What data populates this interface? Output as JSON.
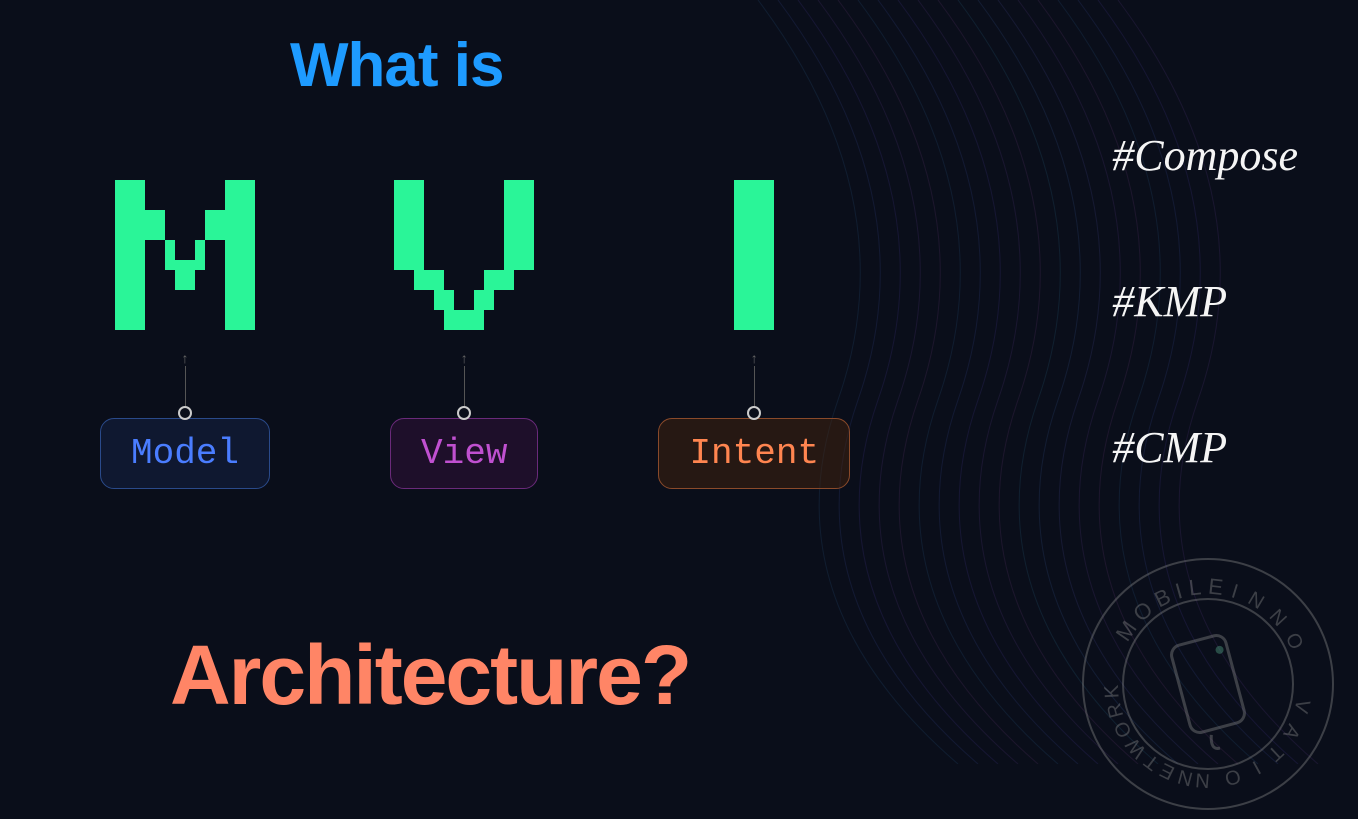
{
  "heading": {
    "top": "What is",
    "bottom": "Architecture?"
  },
  "mvi": {
    "letters": [
      "M",
      "V",
      "I"
    ],
    "labels": [
      "Model",
      "View",
      "Intent"
    ]
  },
  "tags": [
    "#Compose",
    "#KMP",
    "#CMP"
  ],
  "stamp": {
    "words": [
      "MOBILE",
      "INNOVATION",
      "NETWORK"
    ]
  },
  "colors": {
    "green": "#2af598",
    "blue": "#1e9bff",
    "coral": "#ff8566"
  }
}
